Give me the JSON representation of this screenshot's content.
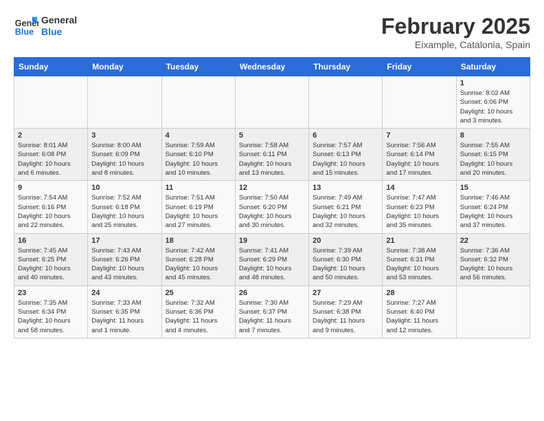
{
  "header": {
    "logo_general": "General",
    "logo_blue": "Blue",
    "month_year": "February 2025",
    "location": "Eixample, Catalonia, Spain"
  },
  "weekdays": [
    "Sunday",
    "Monday",
    "Tuesday",
    "Wednesday",
    "Thursday",
    "Friday",
    "Saturday"
  ],
  "weeks": [
    [
      {
        "day": "",
        "info": ""
      },
      {
        "day": "",
        "info": ""
      },
      {
        "day": "",
        "info": ""
      },
      {
        "day": "",
        "info": ""
      },
      {
        "day": "",
        "info": ""
      },
      {
        "day": "",
        "info": ""
      },
      {
        "day": "1",
        "info": "Sunrise: 8:02 AM\nSunset: 6:06 PM\nDaylight: 10 hours\nand 3 minutes."
      }
    ],
    [
      {
        "day": "2",
        "info": "Sunrise: 8:01 AM\nSunset: 6:08 PM\nDaylight: 10 hours\nand 6 minutes."
      },
      {
        "day": "3",
        "info": "Sunrise: 8:00 AM\nSunset: 6:09 PM\nDaylight: 10 hours\nand 8 minutes."
      },
      {
        "day": "4",
        "info": "Sunrise: 7:59 AM\nSunset: 6:10 PM\nDaylight: 10 hours\nand 10 minutes."
      },
      {
        "day": "5",
        "info": "Sunrise: 7:58 AM\nSunset: 6:11 PM\nDaylight: 10 hours\nand 13 minutes."
      },
      {
        "day": "6",
        "info": "Sunrise: 7:57 AM\nSunset: 6:13 PM\nDaylight: 10 hours\nand 15 minutes."
      },
      {
        "day": "7",
        "info": "Sunrise: 7:56 AM\nSunset: 6:14 PM\nDaylight: 10 hours\nand 17 minutes."
      },
      {
        "day": "8",
        "info": "Sunrise: 7:55 AM\nSunset: 6:15 PM\nDaylight: 10 hours\nand 20 minutes."
      }
    ],
    [
      {
        "day": "9",
        "info": "Sunrise: 7:54 AM\nSunset: 6:16 PM\nDaylight: 10 hours\nand 22 minutes."
      },
      {
        "day": "10",
        "info": "Sunrise: 7:52 AM\nSunset: 6:18 PM\nDaylight: 10 hours\nand 25 minutes."
      },
      {
        "day": "11",
        "info": "Sunrise: 7:51 AM\nSunset: 6:19 PM\nDaylight: 10 hours\nand 27 minutes."
      },
      {
        "day": "12",
        "info": "Sunrise: 7:50 AM\nSunset: 6:20 PM\nDaylight: 10 hours\nand 30 minutes."
      },
      {
        "day": "13",
        "info": "Sunrise: 7:49 AM\nSunset: 6:21 PM\nDaylight: 10 hours\nand 32 minutes."
      },
      {
        "day": "14",
        "info": "Sunrise: 7:47 AM\nSunset: 6:23 PM\nDaylight: 10 hours\nand 35 minutes."
      },
      {
        "day": "15",
        "info": "Sunrise: 7:46 AM\nSunset: 6:24 PM\nDaylight: 10 hours\nand 37 minutes."
      }
    ],
    [
      {
        "day": "16",
        "info": "Sunrise: 7:45 AM\nSunset: 6:25 PM\nDaylight: 10 hours\nand 40 minutes."
      },
      {
        "day": "17",
        "info": "Sunrise: 7:43 AM\nSunset: 6:26 PM\nDaylight: 10 hours\nand 43 minutes."
      },
      {
        "day": "18",
        "info": "Sunrise: 7:42 AM\nSunset: 6:28 PM\nDaylight: 10 hours\nand 45 minutes."
      },
      {
        "day": "19",
        "info": "Sunrise: 7:41 AM\nSunset: 6:29 PM\nDaylight: 10 hours\nand 48 minutes."
      },
      {
        "day": "20",
        "info": "Sunrise: 7:39 AM\nSunset: 6:30 PM\nDaylight: 10 hours\nand 50 minutes."
      },
      {
        "day": "21",
        "info": "Sunrise: 7:38 AM\nSunset: 6:31 PM\nDaylight: 10 hours\nand 53 minutes."
      },
      {
        "day": "22",
        "info": "Sunrise: 7:36 AM\nSunset: 6:32 PM\nDaylight: 10 hours\nand 56 minutes."
      }
    ],
    [
      {
        "day": "23",
        "info": "Sunrise: 7:35 AM\nSunset: 6:34 PM\nDaylight: 10 hours\nand 58 minutes."
      },
      {
        "day": "24",
        "info": "Sunrise: 7:33 AM\nSunset: 6:35 PM\nDaylight: 11 hours\nand 1 minute."
      },
      {
        "day": "25",
        "info": "Sunrise: 7:32 AM\nSunset: 6:36 PM\nDaylight: 11 hours\nand 4 minutes."
      },
      {
        "day": "26",
        "info": "Sunrise: 7:30 AM\nSunset: 6:37 PM\nDaylight: 11 hours\nand 7 minutes."
      },
      {
        "day": "27",
        "info": "Sunrise: 7:29 AM\nSunset: 6:38 PM\nDaylight: 11 hours\nand 9 minutes."
      },
      {
        "day": "28",
        "info": "Sunrise: 7:27 AM\nSunset: 6:40 PM\nDaylight: 11 hours\nand 12 minutes."
      },
      {
        "day": "",
        "info": ""
      }
    ]
  ]
}
